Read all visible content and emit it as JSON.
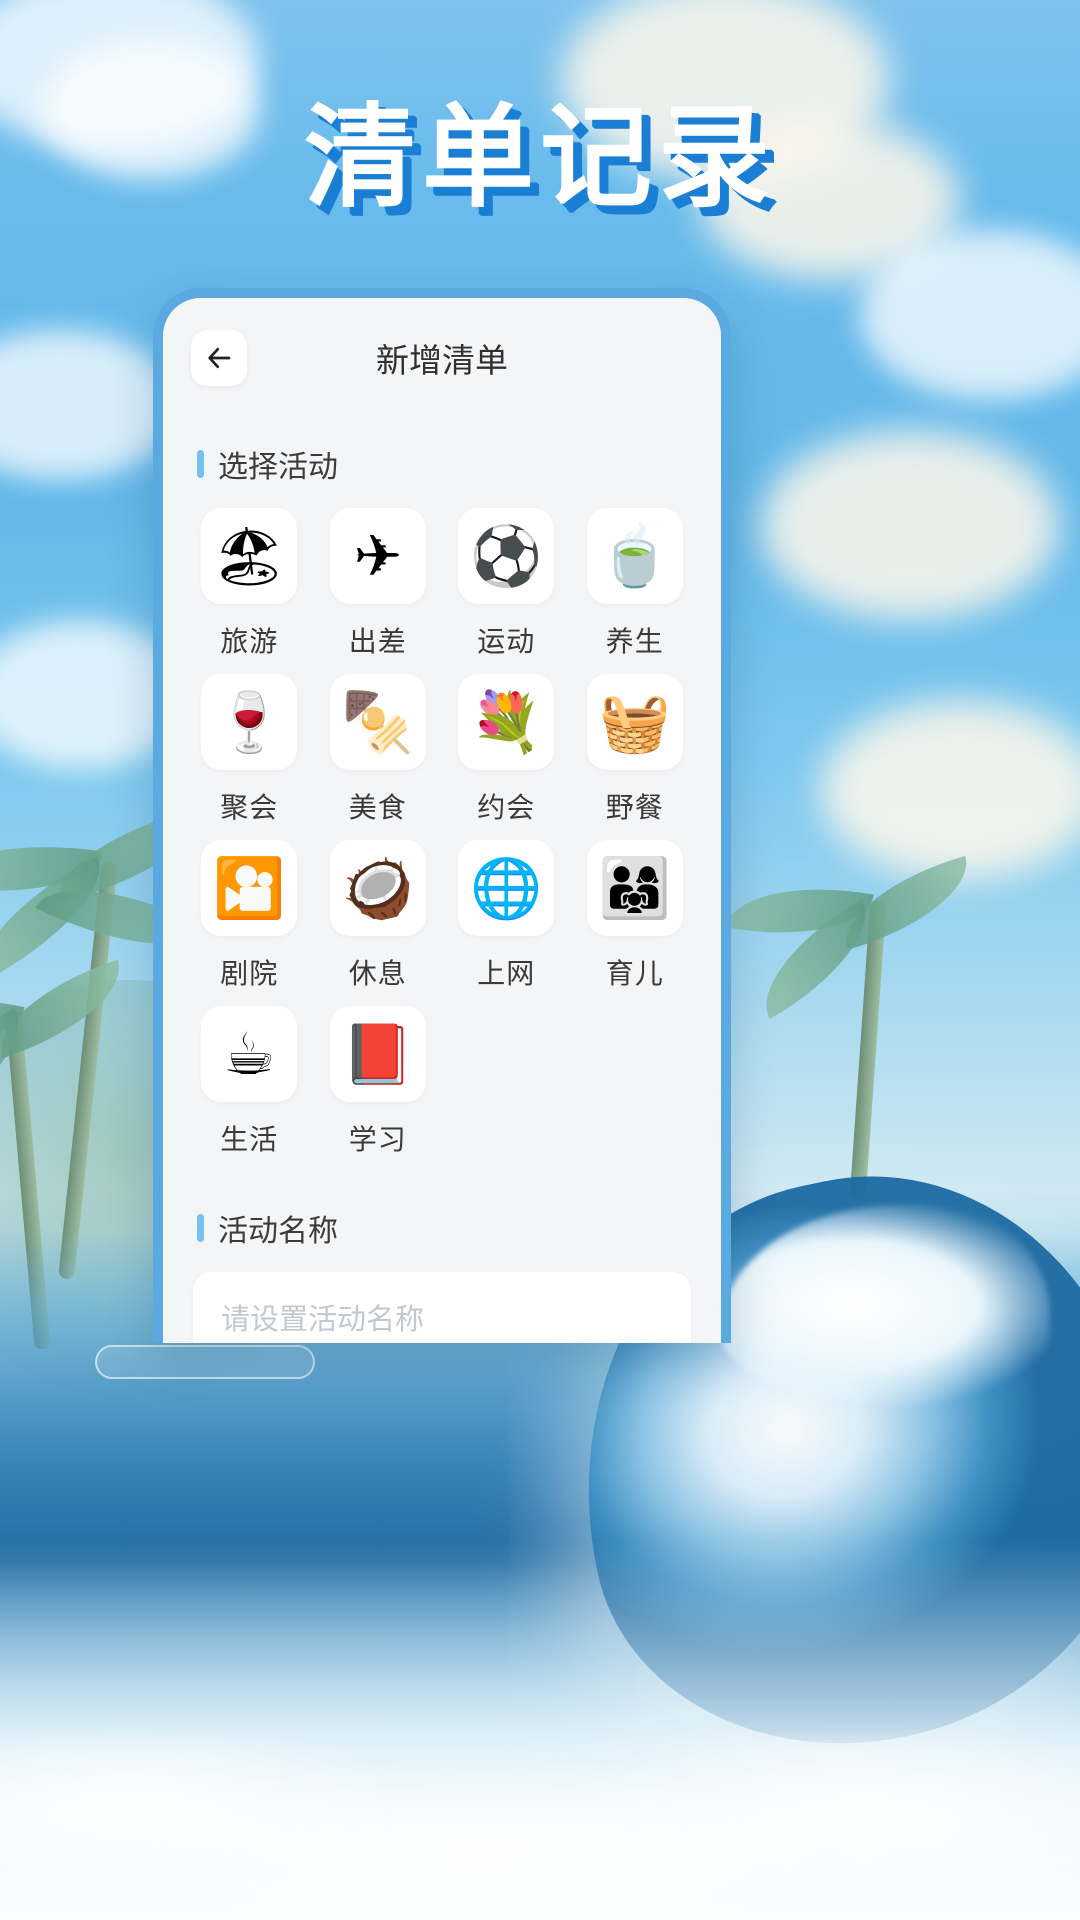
{
  "page": {
    "headline": "清单记录",
    "background_theme": "tropical beach ocean wave illustration",
    "colors": {
      "sky": "#63b8ea",
      "accent": "#74c0f0",
      "phone_border": "#5aa9e0",
      "screen_bg": "#f4f5f7",
      "tile_bg": "#ffffff",
      "headline_shadow": "#1a7fd4"
    }
  },
  "app": {
    "header": {
      "back_icon": "back-arrow-icon",
      "title": "新增清单"
    },
    "sections": [
      {
        "title": "选择活动"
      },
      {
        "title": "活动名称"
      }
    ],
    "activities": [
      {
        "label": "旅游",
        "icon": "beach-umbrella-icon",
        "glyph": "🏖"
      },
      {
        "label": "出差",
        "icon": "airplane-icon",
        "glyph": "✈"
      },
      {
        "label": "运动",
        "icon": "soccer-ball-icon",
        "glyph": "⚽"
      },
      {
        "label": "养生",
        "icon": "teacup-herbal-icon",
        "glyph": "🍵"
      },
      {
        "label": "聚会",
        "icon": "wine-bottle-glass-icon",
        "glyph": "🍷"
      },
      {
        "label": "美食",
        "icon": "food-platter-icon",
        "glyph": "🍢"
      },
      {
        "label": "约会",
        "icon": "bouquet-icon",
        "glyph": "💐"
      },
      {
        "label": "野餐",
        "icon": "picnic-basket-icon",
        "glyph": "🧺"
      },
      {
        "label": "剧院",
        "icon": "theater-stage-icon",
        "glyph": "🎦"
      },
      {
        "label": "休息",
        "icon": "tropical-drink-icon",
        "glyph": "🥥"
      },
      {
        "label": "上网",
        "icon": "globe-cursor-icon",
        "glyph": "🌐"
      },
      {
        "label": "育儿",
        "icon": "family-icon",
        "glyph": "👨‍👩‍👧"
      },
      {
        "label": "生活",
        "icon": "coffee-cup-icon",
        "glyph": "☕"
      },
      {
        "label": "学习",
        "icon": "closed-book-icon",
        "glyph": "📕"
      }
    ],
    "name_field": {
      "value": "",
      "placeholder": "请设置活动名称"
    }
  }
}
